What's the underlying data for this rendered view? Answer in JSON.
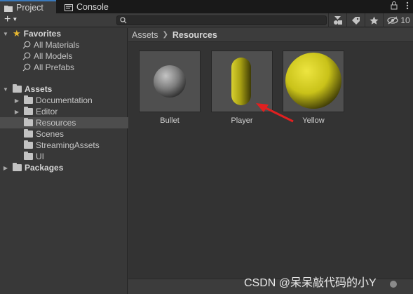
{
  "tabs": [
    {
      "label": "Project",
      "icon": "folder-icon",
      "active": true
    },
    {
      "label": "Console",
      "icon": "console-icon",
      "active": false
    }
  ],
  "tabbar_right": {
    "lock_icon": "lock-icon",
    "menu_icon": "kebab-menu-icon"
  },
  "toolbar": {
    "add_icon": "plus-icon",
    "search_icon": "search-icon",
    "search_value": "",
    "buttons": [
      "filter-by-type-icon",
      "filter-by-label-icon",
      "favorite-star-icon"
    ],
    "hidden_count": "10"
  },
  "tree": {
    "favorites": {
      "label": "Favorites",
      "items": [
        "All Materials",
        "All Models",
        "All Prefabs"
      ]
    },
    "assets": {
      "label": "Assets",
      "children": [
        "Documentation",
        "Editor",
        "Resources",
        "Scenes",
        "StreamingAssets",
        "UI"
      ],
      "selected": "Resources"
    },
    "packages": {
      "label": "Packages"
    }
  },
  "breadcrumb": {
    "root": "Assets",
    "current": "Resources"
  },
  "assets": [
    {
      "label": "Bullet",
      "kind": "sphere",
      "color": "#7d7d7d"
    },
    {
      "label": "Player",
      "kind": "capsule",
      "color": "#a9a213"
    },
    {
      "label": "Yellow",
      "kind": "sphere",
      "color": "#c9c219"
    }
  ],
  "watermark": "CSDN @呆呆敲代码的小Y"
}
